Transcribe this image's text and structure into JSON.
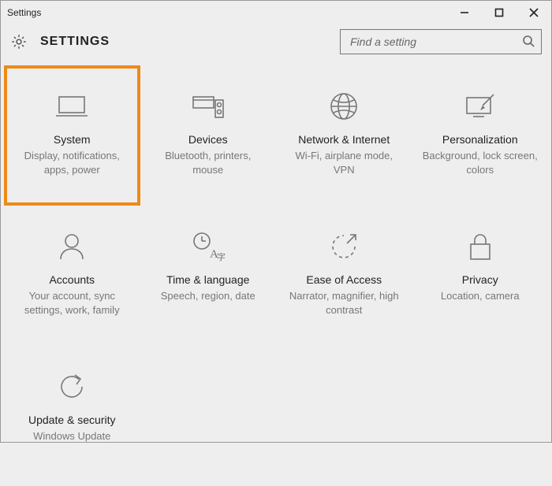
{
  "window": {
    "title": "Settings"
  },
  "header": {
    "heading": "SETTINGS"
  },
  "search": {
    "placeholder": "Find a setting"
  },
  "tiles": [
    {
      "title": "System",
      "desc": "Display, notifications, apps, power"
    },
    {
      "title": "Devices",
      "desc": "Bluetooth, printers, mouse"
    },
    {
      "title": "Network & Internet",
      "desc": "Wi-Fi, airplane mode, VPN"
    },
    {
      "title": "Personalization",
      "desc": "Background, lock screen, colors"
    },
    {
      "title": "Accounts",
      "desc": "Your account, sync settings, work, family"
    },
    {
      "title": "Time & language",
      "desc": "Speech, region, date"
    },
    {
      "title": "Ease of Access",
      "desc": "Narrator, magnifier, high contrast"
    },
    {
      "title": "Privacy",
      "desc": "Location, camera"
    },
    {
      "title": "Update & security",
      "desc": "Windows Update"
    }
  ]
}
